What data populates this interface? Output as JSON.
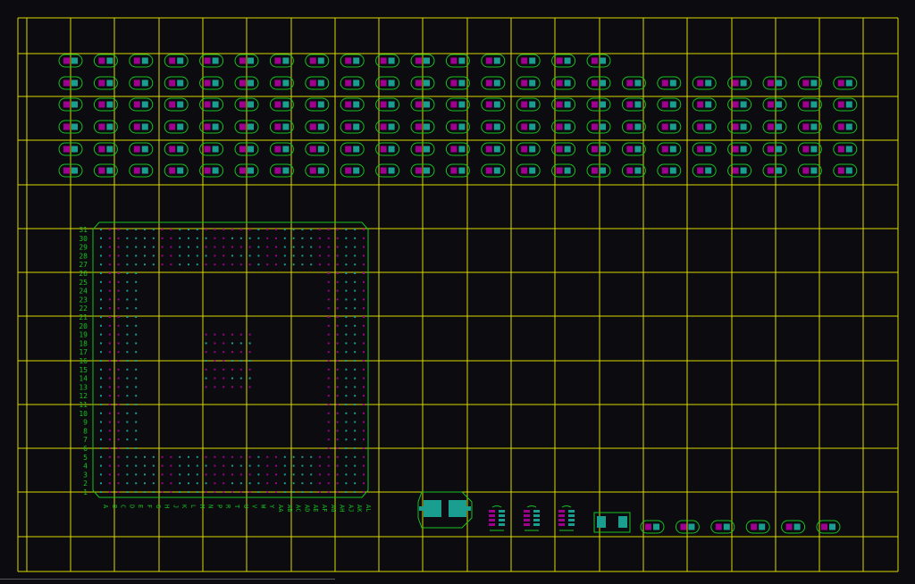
{
  "window": {
    "title": ""
  },
  "colors": {
    "background": "#0b0b10",
    "grid": "#d8d800",
    "outline": "#17c21e",
    "pad_magenta": "#a0008f",
    "pad_teal": "#1a9e90",
    "label": "#17c21e"
  },
  "bga": {
    "rows": [
      "31",
      "30",
      "29",
      "28",
      "27",
      "26",
      "25",
      "24",
      "23",
      "22",
      "21",
      "20",
      "19",
      "18",
      "17",
      "16",
      "15",
      "14",
      "13",
      "12",
      "11",
      "10",
      "9",
      "8",
      "7",
      "6",
      "5",
      "4",
      "3",
      "2",
      "1"
    ],
    "columns": [
      "A",
      "B",
      "C",
      "D",
      "E",
      "F",
      "G",
      "H",
      "J",
      "K",
      "L",
      "M",
      "N",
      "P",
      "R",
      "T",
      "U",
      "V",
      "W",
      "Y",
      "AA",
      "AB",
      "AC",
      "AD",
      "AE",
      "AF",
      "AG",
      "AH",
      "AJ",
      "AK",
      "AL"
    ]
  },
  "components": {
    "small_pad_rows": 6,
    "small_pad_cols": 23,
    "first_row_count": 16,
    "bottom_row_count": 6
  }
}
